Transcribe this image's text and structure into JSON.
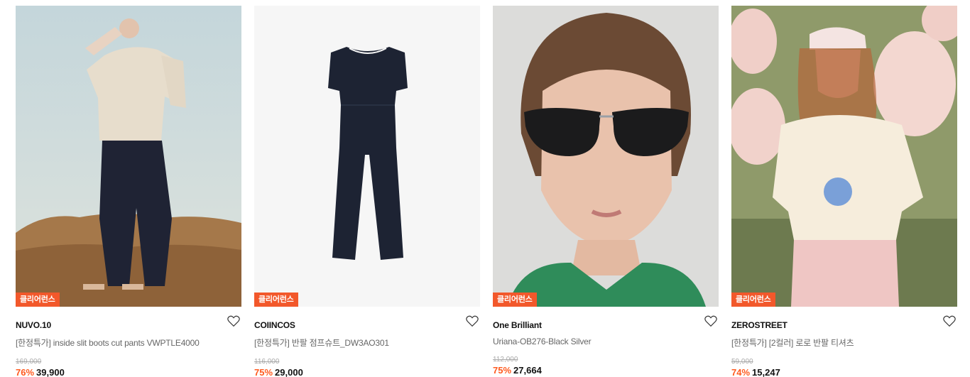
{
  "colors": {
    "accent": "#ff5a1f",
    "badge_bg": "#f2582b"
  },
  "products": [
    {
      "brand": "NUVO.10",
      "badge": "클리어런스",
      "name": "[한정특가] inside slit boots cut pants VWPTLE4000",
      "original_price": "169,000",
      "discount": "76%",
      "price": "39,900",
      "image": "model-wearing-beige-blouse-and-navy-flared-pants-on-sand"
    },
    {
      "brand": "COIINCOS",
      "badge": "클리어런스",
      "name": "[한정특가] 반팔 점프슈트_DW3AO301",
      "original_price": "116,000",
      "discount": "75%",
      "price": "29,000",
      "image": "navy-short-sleeve-jumpsuit-flat-lay"
    },
    {
      "brand": "One Brilliant",
      "badge": "클리어런스",
      "name": "Uriana-OB276-Black Silver",
      "original_price": "112,000",
      "discount": "75%",
      "price": "27,664",
      "image": "woman-wearing-black-round-sunglasses"
    },
    {
      "brand": "ZEROSTREET",
      "badge": "클리어런스",
      "name": "[한정특가] [2컬러] 로로 반팔 티셔츠",
      "original_price": "59,000",
      "discount": "74%",
      "price": "15,247",
      "image": "woman-with-pink-balloons-in-graphic-tee"
    }
  ]
}
